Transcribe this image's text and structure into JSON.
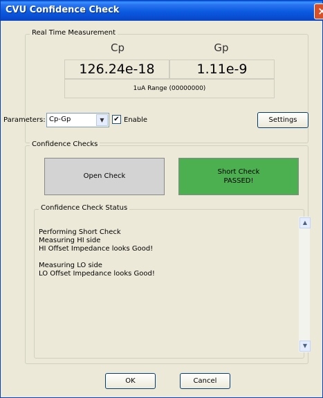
{
  "window": {
    "title": "CVU Confidence Check",
    "close_symbol": "×"
  },
  "realtime": {
    "group_label": "Real Time Measurement",
    "col1_header": "Cp",
    "col2_header": "Gp",
    "col1_value": "126.24e-18",
    "col2_value": "1.11e-9",
    "range_text": "1uA Range (00000000)"
  },
  "params": {
    "label": "Parameters:",
    "selected": "Cp-Gp",
    "enable_label": "Enable",
    "enable_checked": true,
    "settings_label": "Settings"
  },
  "confidence": {
    "group_label": "Confidence Checks",
    "open_label": "Open Check",
    "short_label_line1": "Short Check",
    "short_label_line2": "PASSED!",
    "short_color": "#4caf50",
    "status_group_label": "Confidence Check Status",
    "status_lines": [
      "Performing Short Check",
      "Measuring HI side",
      "HI Offset Impedance looks Good!",
      "",
      "Measuring LO side",
      "LO Offset Impedance looks Good!"
    ]
  },
  "footer": {
    "ok_label": "OK",
    "cancel_label": "Cancel"
  }
}
